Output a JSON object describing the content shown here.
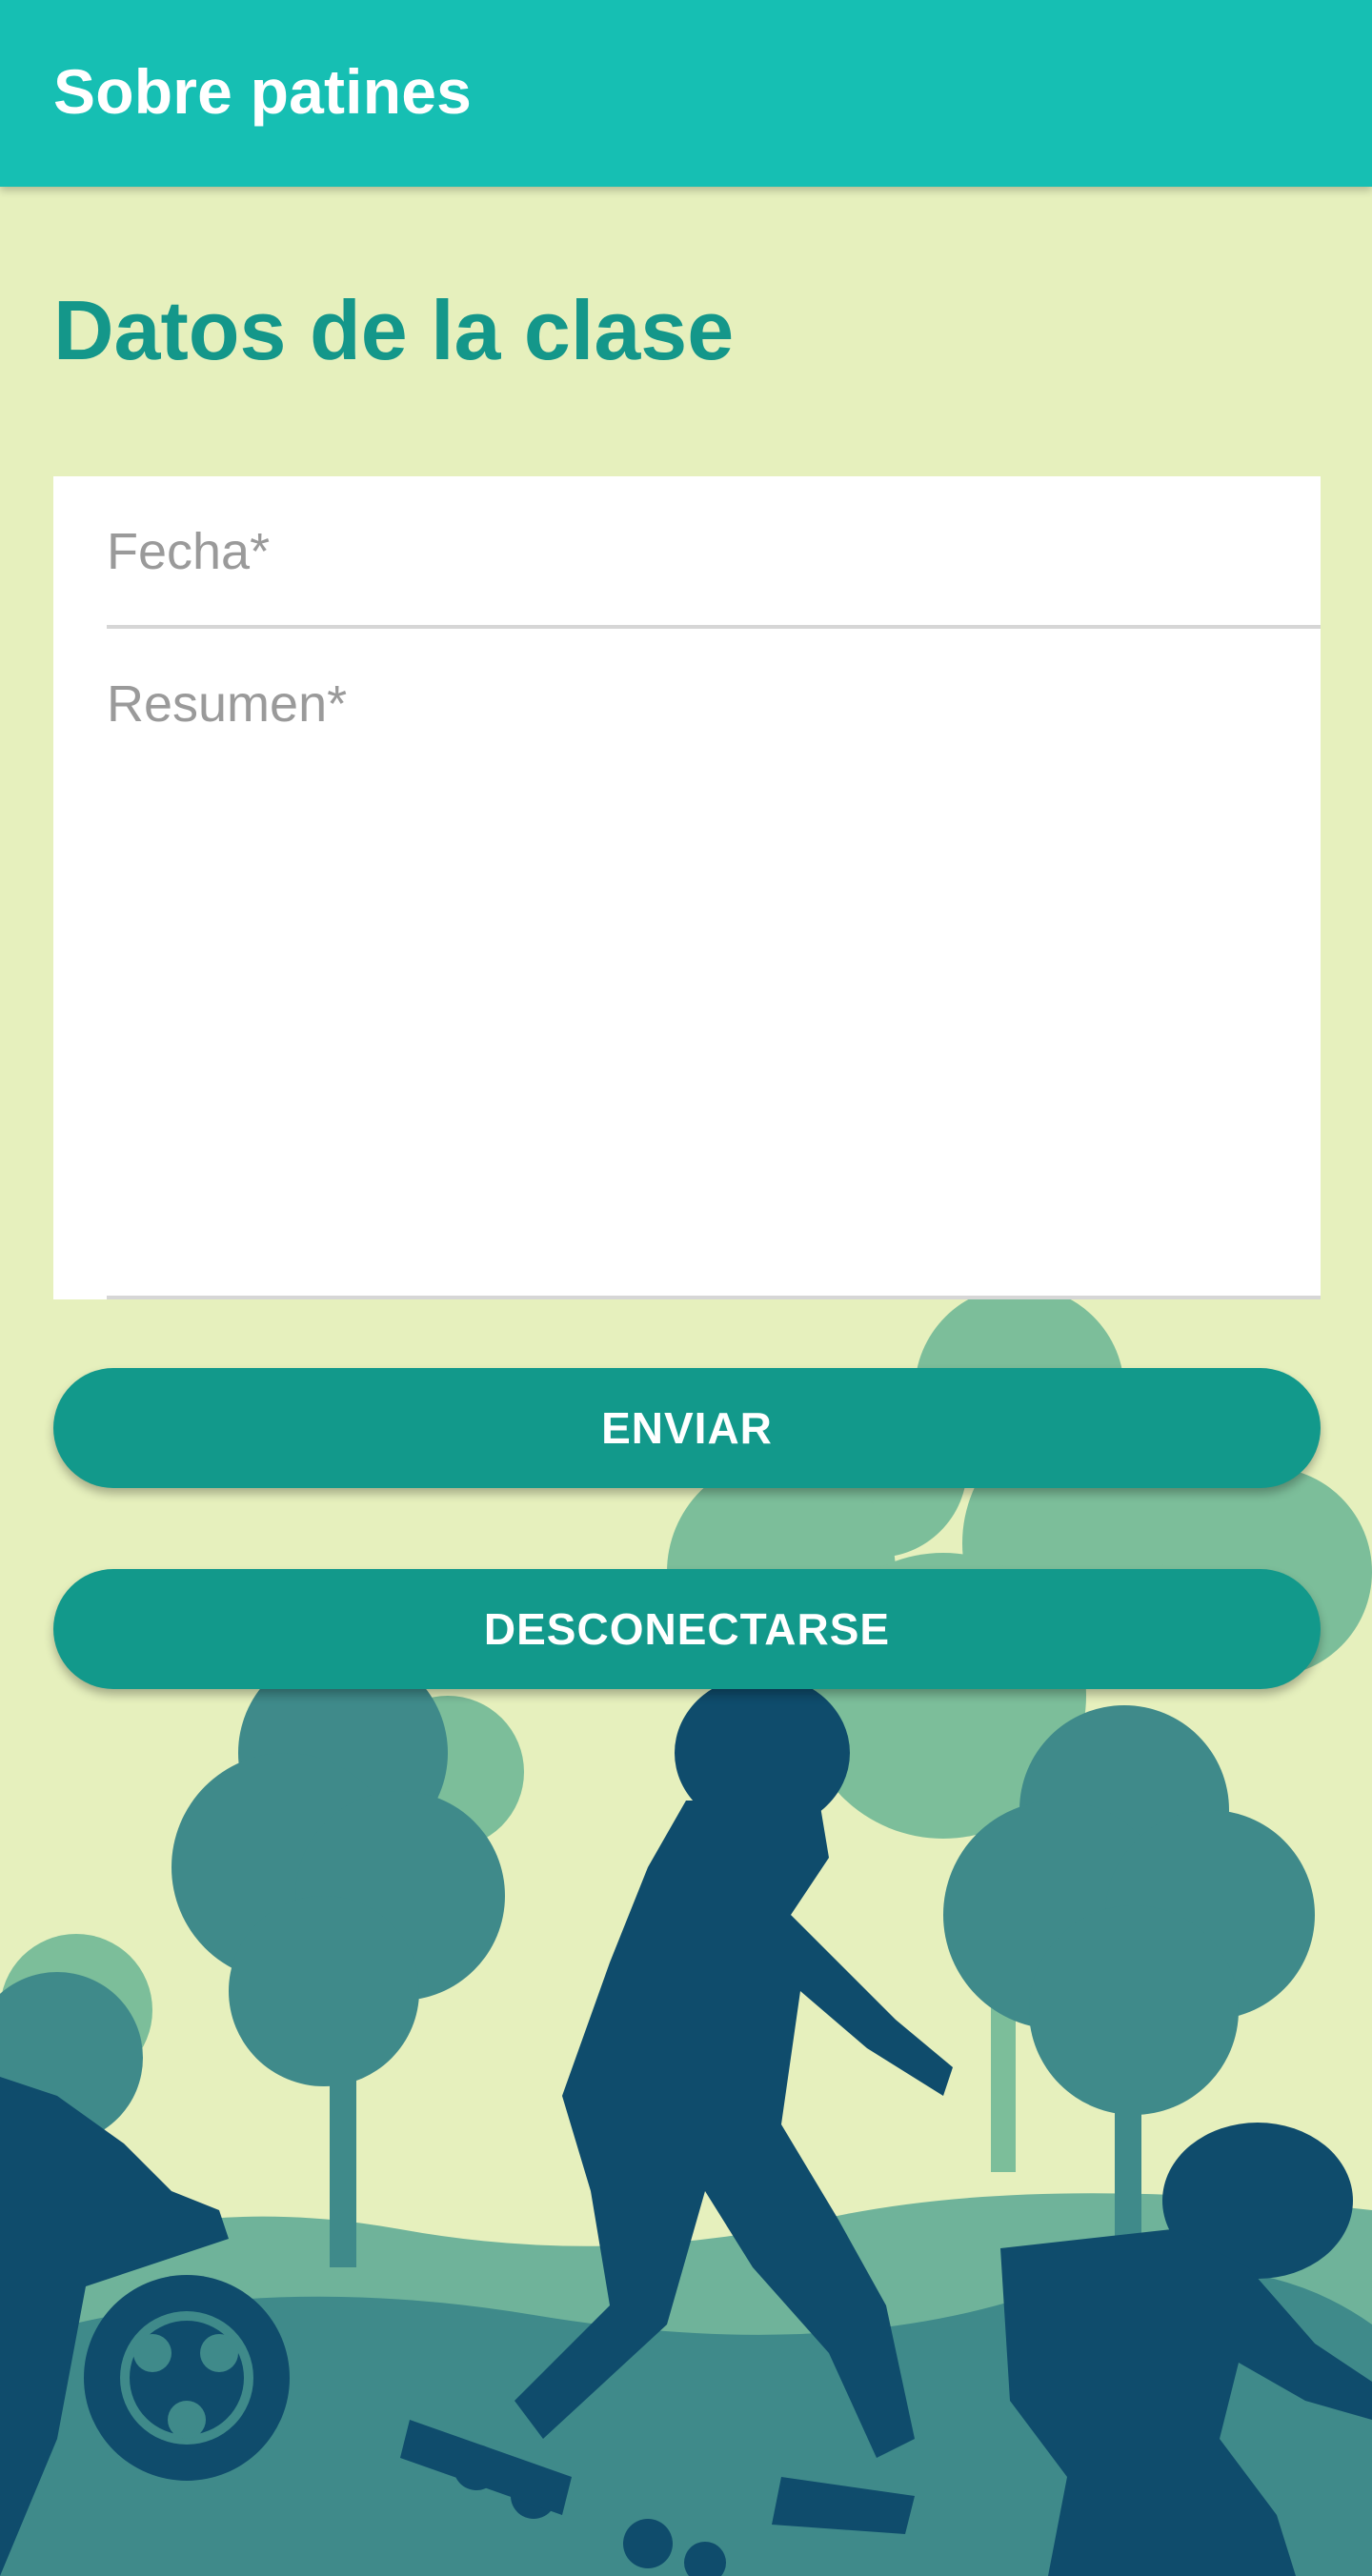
{
  "app_bar": {
    "title": "Sobre patines"
  },
  "form": {
    "title": "Datos de la clase",
    "date_field": {
      "placeholder": "Fecha*",
      "value": ""
    },
    "summary_field": {
      "placeholder": "Resumen*",
      "value": ""
    }
  },
  "buttons": {
    "send": "ENVIAR",
    "logout": "DESCONECTARSE"
  },
  "illustration": {
    "subject": "children-roller-skating-park-silhouette"
  },
  "colors": {
    "app_bar": "#16bfb3",
    "accent": "#14978a",
    "button": "#12998b",
    "background": "#e6f0bd",
    "tree_light": "#7cbe9a",
    "tree_mid": "#3f8a8a",
    "skater": "#0f4c6c"
  }
}
